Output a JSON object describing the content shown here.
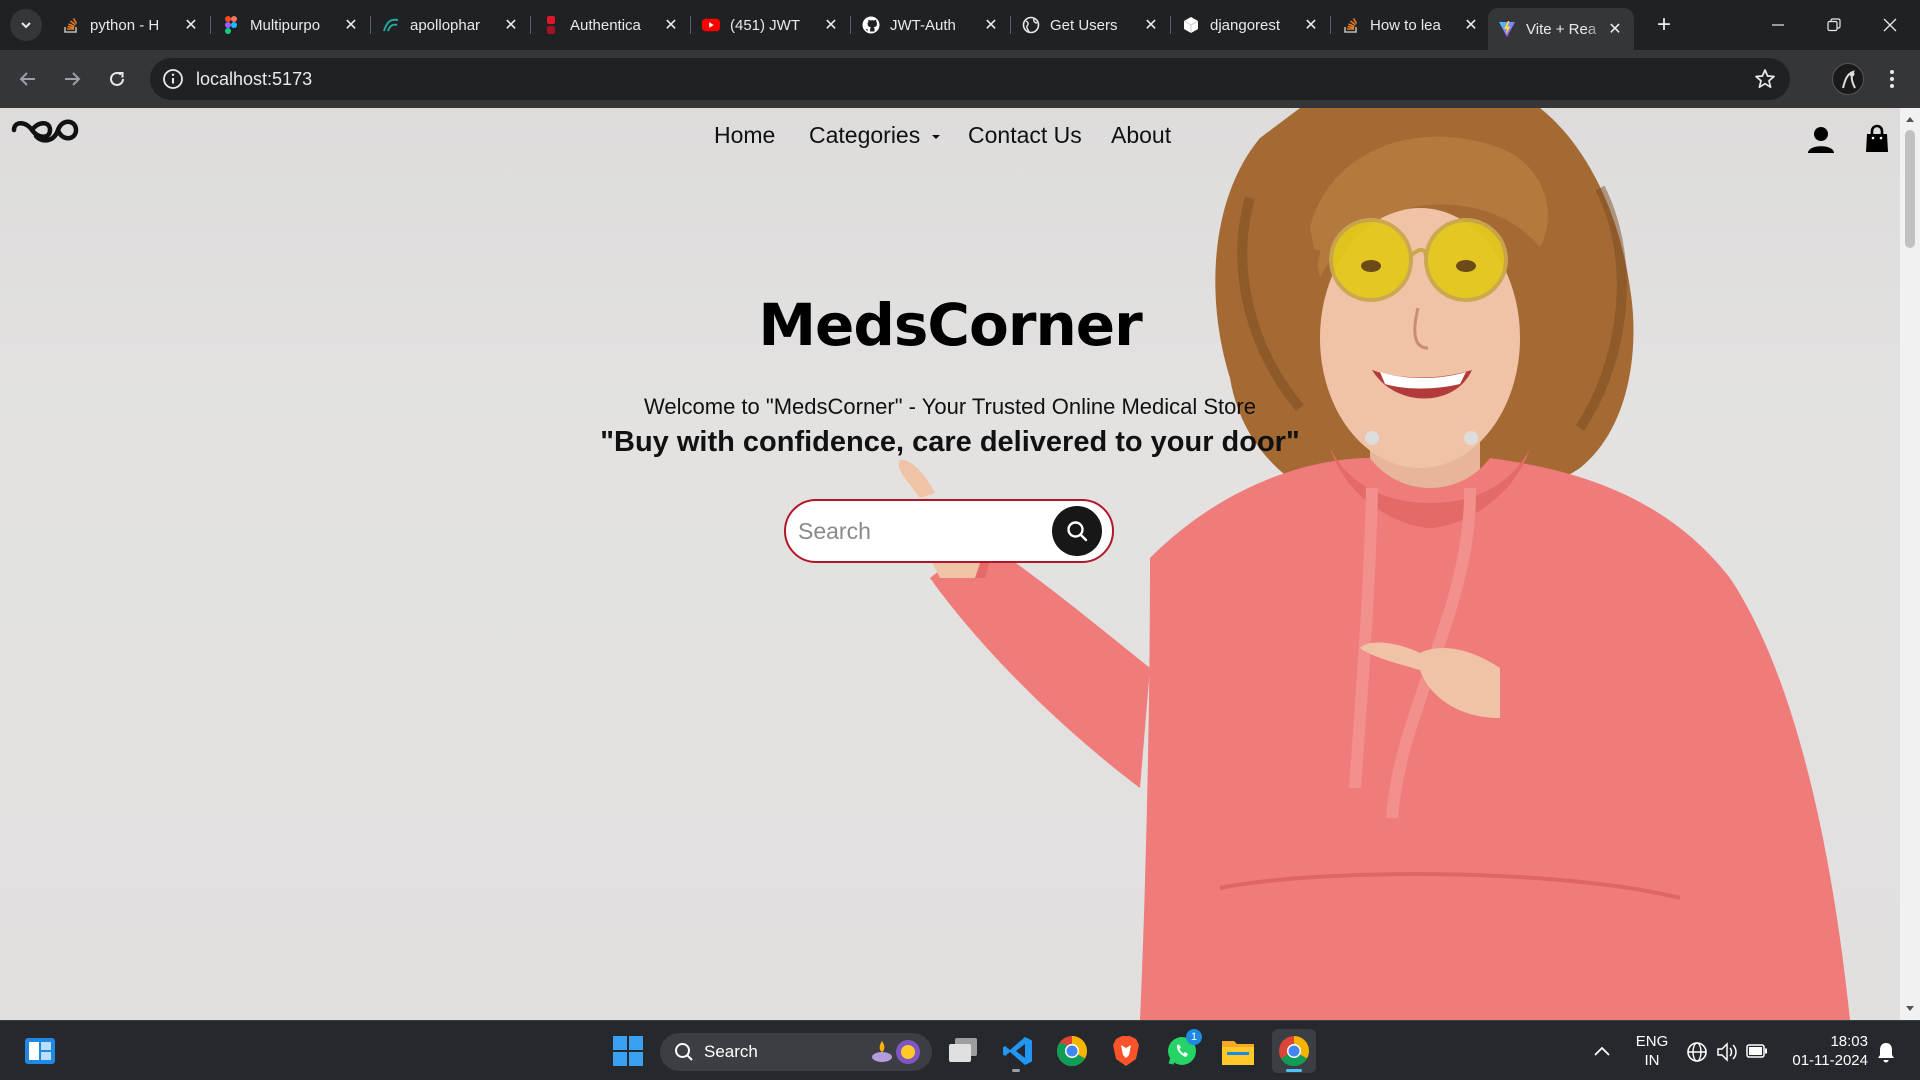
{
  "browser": {
    "tabs": [
      {
        "title": "python - H",
        "favicon": "stackoverflow-icon",
        "active": false
      },
      {
        "title": "Multipurpo",
        "favicon": "figma-icon",
        "active": false
      },
      {
        "title": "apollophar",
        "favicon": "apollo-icon",
        "active": false
      },
      {
        "title": "Authentica",
        "favicon": "auth-icon",
        "active": false
      },
      {
        "title": "(451) JWT",
        "favicon": "youtube-icon",
        "active": false
      },
      {
        "title": "JWT-Auth",
        "favicon": "github-icon",
        "active": false
      },
      {
        "title": "Get Users",
        "favicon": "globe-icon",
        "active": false
      },
      {
        "title": "djangorest",
        "favicon": "cube-icon",
        "active": false
      },
      {
        "title": "How to lea",
        "favicon": "stackoverflow-icon",
        "active": false
      },
      {
        "title": "Vite + Rea",
        "favicon": "vite-icon",
        "active": true
      }
    ],
    "url": "localhost:5173"
  },
  "site": {
    "nav": {
      "home": "Home",
      "categories": "Categories",
      "contact": "Contact Us",
      "about": "About"
    },
    "hero": {
      "title": "MedsCorner",
      "subtitle": "Welcome to \"MedsCorner\" - Your Trusted Online Medical Store",
      "tagline": "\"Buy with confidence, care delivered to your door\""
    },
    "search": {
      "placeholder": "Search"
    }
  },
  "taskbar": {
    "search_label": "Search",
    "whatsapp_badge": "1",
    "lang_line1": "ENG",
    "lang_line2": "IN",
    "time": "18:03",
    "date": "01-11-2024"
  },
  "colors": {
    "search_border": "#b0182a",
    "hoodie": "#ef7c7a",
    "page_bg": "#e0dfde"
  }
}
